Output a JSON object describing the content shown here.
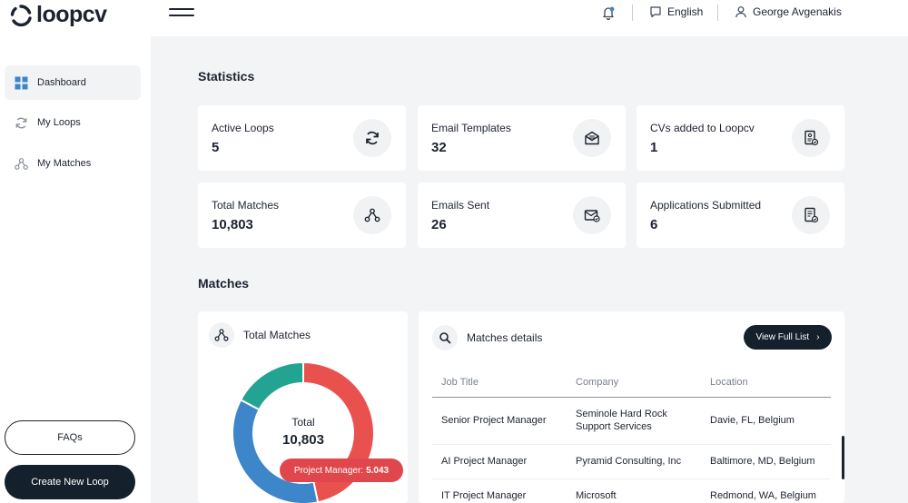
{
  "app": {
    "logo_text": "loopcv"
  },
  "header": {
    "language": "English",
    "user_name": "George Avgenakis"
  },
  "sidebar": {
    "items": [
      {
        "label": "Dashboard",
        "icon": "dashboard-icon",
        "active": true
      },
      {
        "label": "My Loops",
        "icon": "loop-icon",
        "active": false
      },
      {
        "label": "My Matches",
        "icon": "matches-icon",
        "active": false
      }
    ],
    "faq_label": "FAQs",
    "new_loop_label": "Create New Loop"
  },
  "statistics": {
    "title": "Statistics",
    "cards": [
      {
        "label": "Active Loops",
        "value": "5",
        "icon": "refresh-icon"
      },
      {
        "label": "Email Templates",
        "value": "32",
        "icon": "email-template-icon"
      },
      {
        "label": "CVs added to Loopcv",
        "value": "1",
        "icon": "cv-icon"
      },
      {
        "label": "Total Matches",
        "value": "10,803",
        "icon": "network-icon"
      },
      {
        "label": "Emails Sent",
        "value": "26",
        "icon": "email-sent-icon"
      },
      {
        "label": "Applications Submitted",
        "value": "6",
        "icon": "application-icon"
      }
    ]
  },
  "matches": {
    "title": "Matches",
    "total_panel": {
      "title": "Total Matches",
      "center_label": "Total",
      "center_value": "10,803",
      "tooltip_label": "Project Manager:",
      "tooltip_value": "5.043"
    },
    "details_panel": {
      "title": "Matches details",
      "view_full_list_label": "View Full List",
      "columns": [
        "Job Title",
        "Company",
        "Location"
      ],
      "rows": [
        {
          "job_title": "Senior Project Manager",
          "company": "Seminole Hard Rock Support Services",
          "location": "Davie, FL, Belgium"
        },
        {
          "job_title": "AI Project Manager",
          "company": "Pyramid Consulting, Inc",
          "location": "Baltimore, MD, Belgium"
        },
        {
          "job_title": "IT Project Manager",
          "company": "Microsoft",
          "location": "Redmond, WA, Belgium"
        }
      ]
    }
  },
  "chart_data": {
    "type": "pie",
    "title": "",
    "series": [
      {
        "name": "Project Manager",
        "value": 5043,
        "color": "#e9514f"
      },
      {
        "value": 3900,
        "color": "#3d86c9"
      },
      {
        "value": 1860,
        "color": "#23a391"
      }
    ],
    "total": 10803
  },
  "colors": {
    "accent_dark": "#14202c",
    "tooltip_red": "#e0474c",
    "page_bg": "#f3f4f6"
  }
}
